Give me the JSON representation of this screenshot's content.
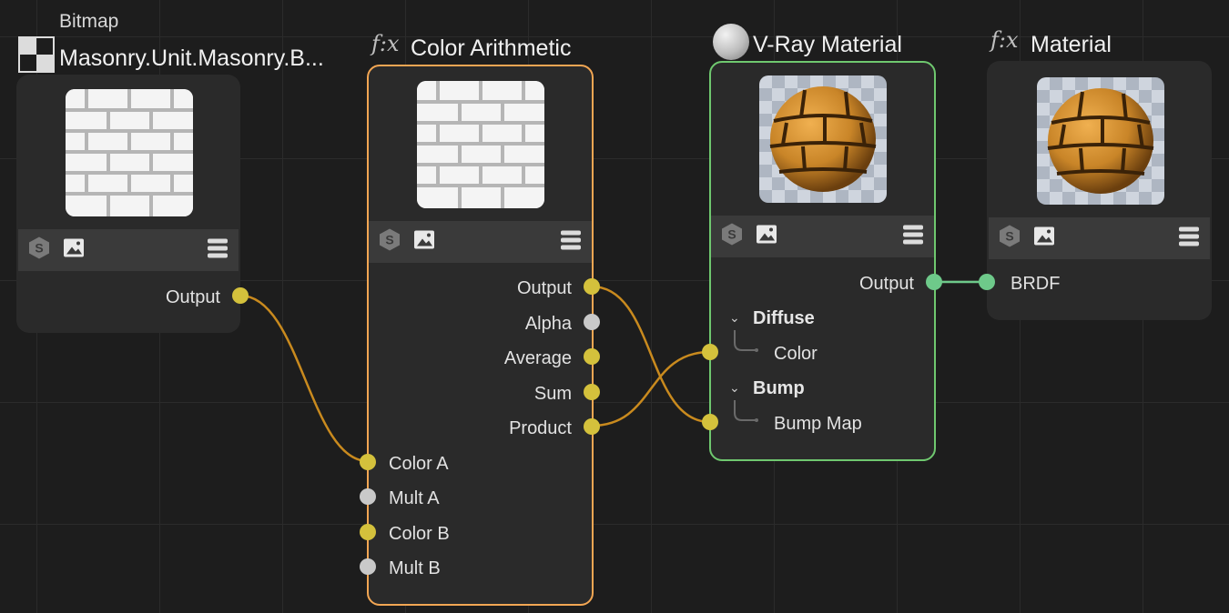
{
  "bitmap_node": {
    "subtitle": "Bitmap",
    "title": "Masonry.Unit.Masonry.B...",
    "outputs": [
      "Output"
    ],
    "icons": [
      "checker-icon",
      "substance-icon",
      "image-icon",
      "menu-icon"
    ]
  },
  "color_arith_node": {
    "fx": "f:x",
    "title": "Color Arithmetic",
    "outputs": [
      "Output",
      "Alpha",
      "Average",
      "Sum",
      "Product"
    ],
    "inputs": [
      "Color A",
      "Mult A",
      "Color B",
      "Mult B"
    ]
  },
  "vray_node": {
    "title": "V-Ray Material",
    "outputs": [
      "Output"
    ],
    "groups": [
      {
        "label": "Diffuse",
        "items": [
          "Color"
        ]
      },
      {
        "label": "Bump",
        "items": [
          "Bump Map"
        ]
      }
    ]
  },
  "material_node": {
    "fx": "f:x",
    "title": "Material",
    "inputs": [
      "BRDF"
    ]
  },
  "colors": {
    "wire_orange": "#c98a1e",
    "wire_green": "#6ec98a",
    "port_yellow": "#d4c13c",
    "port_grey": "#c9c9c9",
    "border_orange": "#f2a653",
    "border_green": "#6fc86f"
  }
}
